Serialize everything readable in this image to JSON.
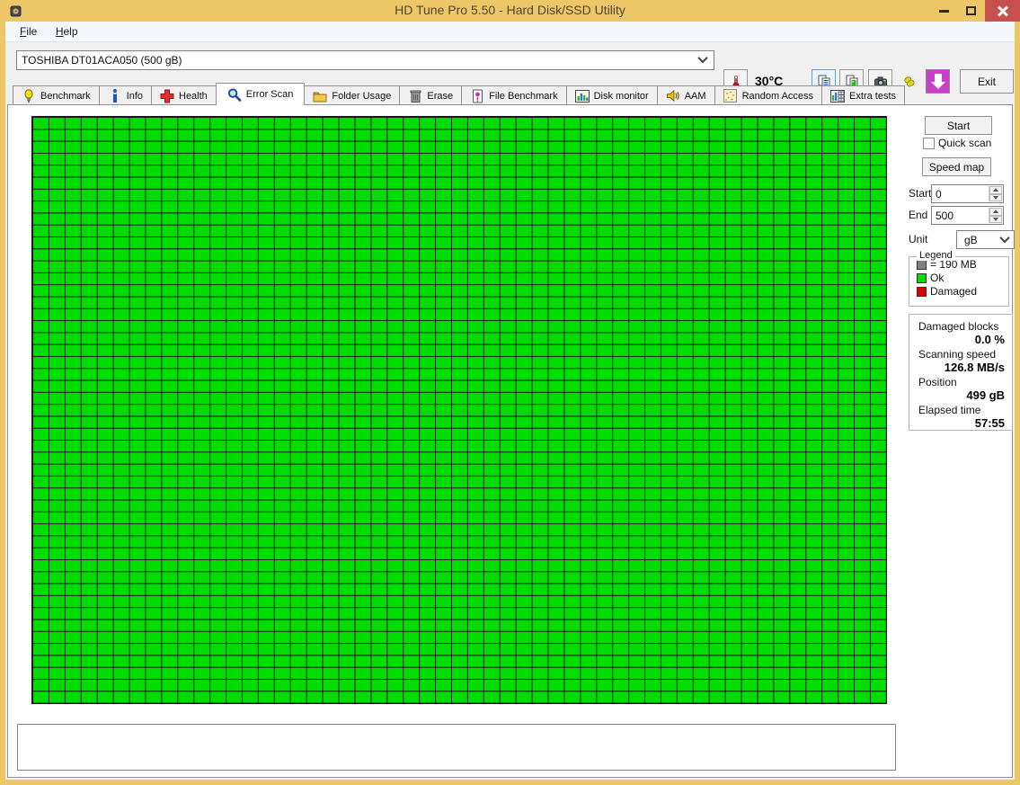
{
  "window": {
    "title": "HD Tune Pro 5.50 - Hard Disk/SSD Utility"
  },
  "menu": {
    "file": "File",
    "help": "Help"
  },
  "toolbar": {
    "drive_selector": "TOSHIBA DT01ACA050 (500 gB)",
    "temperature": "30°C",
    "exit_label": "Exit",
    "icons": [
      "thermometer-icon",
      "copy-text-icon",
      "copy-image-icon",
      "camera-icon",
      "hands-icon",
      "download-arrow-icon"
    ]
  },
  "tabs": [
    {
      "label": "Benchmark",
      "active": false
    },
    {
      "label": "Info",
      "active": false
    },
    {
      "label": "Health",
      "active": false
    },
    {
      "label": "Error Scan",
      "active": true
    },
    {
      "label": "Folder Usage",
      "active": false
    },
    {
      "label": "Erase",
      "active": false
    },
    {
      "label": "File Benchmark",
      "active": false
    },
    {
      "label": "Disk monitor",
      "active": false
    },
    {
      "label": "AAM",
      "active": false
    },
    {
      "label": "Random Access",
      "active": false
    },
    {
      "label": "Extra tests",
      "active": false
    }
  ],
  "error_scan": {
    "start_button": "Start",
    "quick_scan": {
      "label": "Quick scan",
      "checked": false
    },
    "speed_map_button": "Speed map",
    "start_field": {
      "label": "Start",
      "value": "0"
    },
    "end_field": {
      "label": "End",
      "value": "500"
    },
    "unit_field": {
      "label": "Unit",
      "value": "gB"
    },
    "legend": {
      "title": "Legend",
      "items": [
        {
          "swatch": "#808080",
          "label": "= 190 MB"
        },
        {
          "swatch": "#00dd00",
          "label": "Ok"
        },
        {
          "swatch": "#dd0000",
          "label": "Damaged"
        }
      ]
    },
    "stats": [
      {
        "label": "Damaged blocks",
        "value": "0.0 %"
      },
      {
        "label": "Scanning speed",
        "value": "126.8 MB/s"
      },
      {
        "label": "Position",
        "value": "499 gB"
      },
      {
        "label": "Elapsed time",
        "value": "57:55"
      }
    ]
  },
  "scan_map": {
    "columns": 53,
    "rows": 49,
    "status": "all_ok",
    "ok_color": "#00dd00",
    "damaged_color": "#dd0000",
    "grid_line_color": "#161616"
  },
  "colors": {
    "titlebar": "#ecc667",
    "close_button": "#c7504f",
    "download_button": "#c93fc9",
    "legend_gray": "#808080",
    "ok_green": "#00dd00",
    "damaged_red": "#dd0000"
  }
}
